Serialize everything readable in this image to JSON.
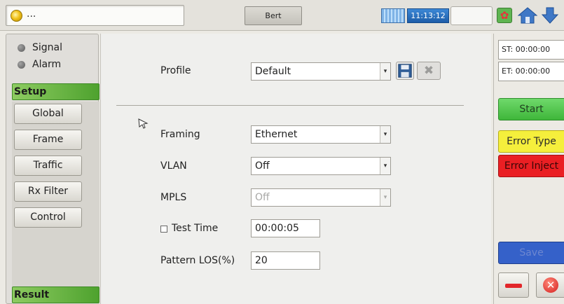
{
  "topbar": {
    "status_text": "...",
    "tab_label": "Bert",
    "clock": "11:13:12",
    "icons": [
      "status-led-icon",
      "network-icon",
      "settings-icon",
      "home-icon",
      "down-arrow-icon"
    ]
  },
  "sidebar": {
    "indicators": [
      {
        "label": "Signal"
      },
      {
        "label": "Alarm"
      }
    ],
    "setup_header": "Setup",
    "nav_items": [
      "Global",
      "Frame",
      "Traffic",
      "Rx Filter",
      "Control"
    ],
    "result_header": "Result"
  },
  "form": {
    "profile": {
      "label": "Profile",
      "value": "Default"
    },
    "framing": {
      "label": "Framing",
      "value": "Ethernet"
    },
    "vlan": {
      "label": "VLAN",
      "value": "Off"
    },
    "mpls": {
      "label": "MPLS",
      "value": "Off",
      "disabled": true
    },
    "test_time": {
      "label": "Test Time",
      "value": "00:00:05",
      "checked": false
    },
    "pattern_los": {
      "label": "Pattern LOS(%)",
      "value": "20"
    }
  },
  "right_panel": {
    "start_time": "ST: 00:00:00",
    "end_time": "ET: 00:00:00",
    "start_label": "Start",
    "error_type_label": "Error Type",
    "error_inject_label": "Error Inject",
    "save_label": "Save"
  },
  "colors": {
    "header_green": "#4ea22e",
    "start_green": "#3fb63a",
    "error_yellow": "#f5ef3c",
    "error_red": "#ea1f23",
    "save_blue": "#3561c9"
  }
}
